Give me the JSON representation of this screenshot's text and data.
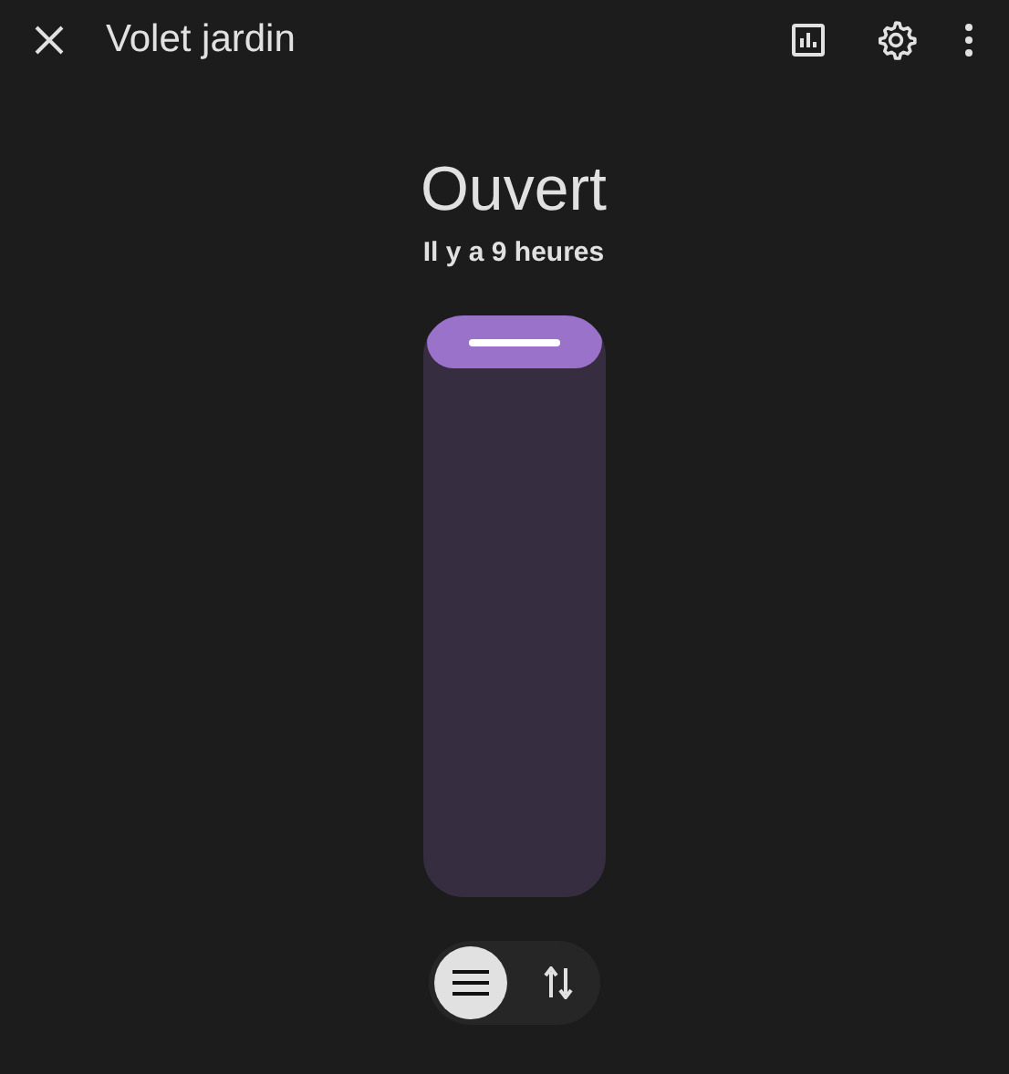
{
  "window": {
    "title": "Volet jardin"
  },
  "state": {
    "label": "Ouvert",
    "time": "Il y a 9 heures"
  },
  "slider": {
    "level": 1
  },
  "modes": [
    {
      "kind": "position",
      "selected": true
    },
    {
      "kind": "tilt",
      "selected": false
    }
  ]
}
